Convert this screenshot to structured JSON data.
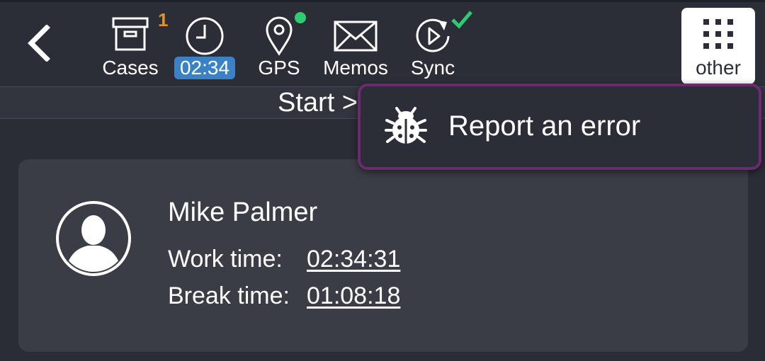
{
  "topbar": {
    "back_icon": "chevron-left-icon",
    "nav": [
      {
        "label": "Cases",
        "icon": "archive-box-icon",
        "badge": "1"
      },
      {
        "label": "02:34",
        "icon": "clock-icon"
      },
      {
        "label": "GPS",
        "icon": "location-pin-icon",
        "status": "active"
      },
      {
        "label": "Memos",
        "icon": "envelope-icon"
      },
      {
        "label": "Sync",
        "icon": "sync-icon",
        "status": "done"
      }
    ],
    "other": {
      "label": "other",
      "icon": "grid-icon"
    }
  },
  "breadcrumb": {
    "text": "Start >"
  },
  "dropdown": {
    "items": [
      {
        "label": "Report an error",
        "icon": "bug-icon"
      }
    ]
  },
  "user_card": {
    "name": "Mike Palmer",
    "work_label": "Work time:",
    "work_value": "02:34:31",
    "break_label": "Break time:",
    "break_value": "01:08:18"
  },
  "colors": {
    "background": "#2a2d36",
    "card": "#3a3d45",
    "accent_blue": "#3a82c4",
    "badge_orange": "#e0922e",
    "status_green": "#2ecc71",
    "menu_border": "#6e2a70"
  }
}
